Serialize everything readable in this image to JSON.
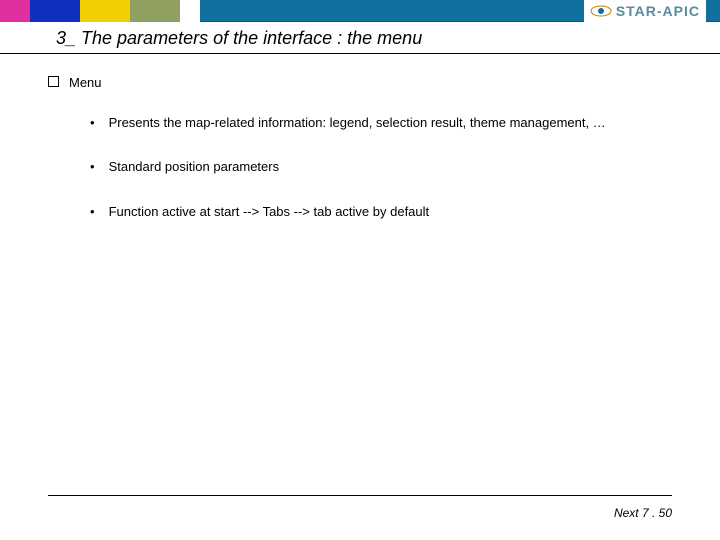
{
  "brand": {
    "name": "STAR-APIC"
  },
  "title": "3_ The parameters of the interface : the menu",
  "section_heading": "Menu",
  "bullets": [
    "Presents the map-related information: legend, selection result, theme management, …",
    "Standard position parameters",
    "Function active at start --> Tabs --> tab active by default"
  ],
  "footer": "Next 7 . 50"
}
